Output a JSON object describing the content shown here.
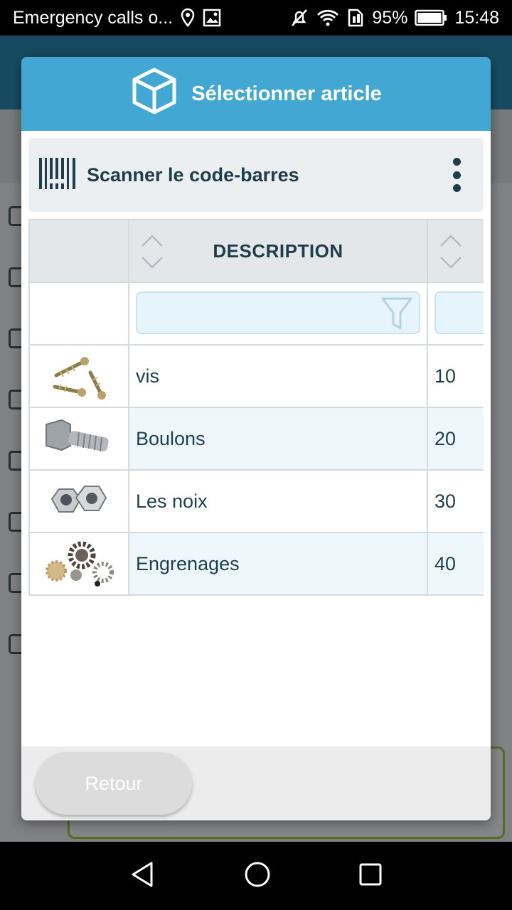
{
  "status_bar": {
    "carrier_text": "Emergency calls o...",
    "battery": "95%",
    "time": "15:48",
    "icons": [
      "location-icon",
      "image-icon",
      "mute-icon",
      "wifi-icon",
      "sim-icon",
      "battery-icon"
    ]
  },
  "dialog": {
    "title": "Sélectionner article",
    "title_icon": "box-icon",
    "scan_label": "Scanner le code-barres",
    "scan_icon": "barcode-icon",
    "menu_icon": "kebab-menu-icon",
    "columns": [
      "",
      "DESCRIPTION",
      ""
    ],
    "rows": [
      {
        "image": "screws",
        "description": "vis",
        "code": "10"
      },
      {
        "image": "bolt",
        "description": "Boulons",
        "code": "20"
      },
      {
        "image": "nuts",
        "description": "Les noix",
        "code": "30"
      },
      {
        "image": "gears",
        "description": "Engrenages",
        "code": "40"
      }
    ],
    "back_button": "Retour"
  },
  "colors": {
    "header": "#42a7d2",
    "text": "#1f3e4a",
    "row_alt": "#eef8fc",
    "filter_bg": "#e6f4fb"
  },
  "nav_bar": {
    "icons": [
      "back-icon",
      "home-icon",
      "recents-icon"
    ]
  }
}
